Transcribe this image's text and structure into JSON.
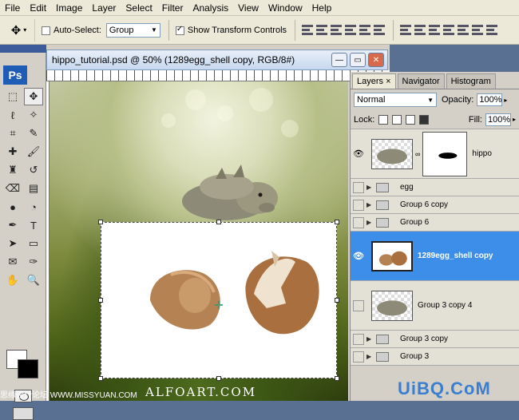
{
  "menu": [
    "File",
    "Edit",
    "Image",
    "Layer",
    "Select",
    "Filter",
    "Analysis",
    "View",
    "Window",
    "Help"
  ],
  "options": {
    "auto_select_label": "Auto-Select:",
    "auto_select_value": "Group",
    "show_transform_label": "Show Transform Controls",
    "auto_select_checked": false,
    "show_transform_checked": true
  },
  "tools": {
    "logo": "Ps"
  },
  "document": {
    "title": "hippo_tutorial.psd @ 50% (1289egg_shell copy, RGB/8#)",
    "watermark": "ALFOART.COM"
  },
  "layers_panel": {
    "tabs": [
      "Layers",
      "Navigator",
      "Histogram"
    ],
    "blend_mode": "Normal",
    "opacity_label": "Opacity:",
    "opacity_value": "100%",
    "lock_label": "Lock:",
    "fill_label": "Fill:",
    "fill_value": "100%",
    "layers": [
      {
        "name": "hippo",
        "type": "layer-with-mask",
        "visible": true
      },
      {
        "name": "egg",
        "type": "group",
        "visible": false
      },
      {
        "name": "Group 6 copy",
        "type": "group",
        "visible": false
      },
      {
        "name": "Group 6",
        "type": "group",
        "visible": false
      },
      {
        "name": "1289egg_shell copy",
        "type": "layer",
        "visible": true,
        "selected": true
      },
      {
        "name": "Group 3 copy 4",
        "type": "layer",
        "visible": false
      },
      {
        "name": "Group 3 copy",
        "type": "group",
        "visible": false
      },
      {
        "name": "Group 3",
        "type": "group",
        "visible": false
      }
    ]
  },
  "watermarks": {
    "site_logo": "UiBQ.CoM",
    "bottom_left": "思缘设计论坛  WWW.MISSYUAN.COM"
  },
  "colors": {
    "selection": "#3d8ee8",
    "accent": "#1f5cb5"
  }
}
